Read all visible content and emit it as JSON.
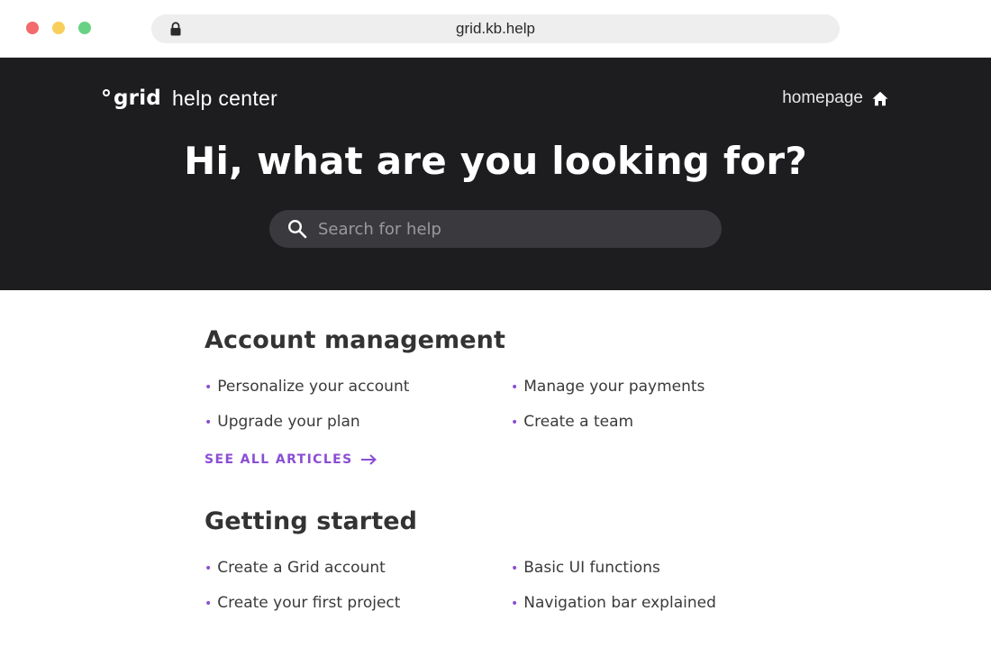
{
  "browser": {
    "url": "grid.kb.help",
    "colors": {
      "close": "#f46b6b",
      "minimize": "#f7cf5a",
      "maximize": "#68d284"
    }
  },
  "header": {
    "logo_word": "grid",
    "logo_subtitle": "help center",
    "home_link": "homepage",
    "title": "Hi, what are you looking for?"
  },
  "search": {
    "placeholder": "Search for help",
    "value": ""
  },
  "sections": [
    {
      "title": "Account management",
      "articles": [
        "Personalize your account",
        "Manage your payments",
        "Upgrade your plan",
        "Create a team"
      ],
      "see_all": "SEE ALL ARTICLES"
    },
    {
      "title": "Getting started",
      "articles": [
        "Create a Grid account",
        "Basic UI functions",
        "Create your first project",
        "Navigation bar explained"
      ]
    }
  ],
  "colors": {
    "accent": "#8a4ed3",
    "hero_bg": "#1d1d20",
    "search_bg": "#3a3a3e"
  },
  "icons": [
    "lock-icon",
    "home-icon",
    "search-icon",
    "arrow-right-icon"
  ]
}
